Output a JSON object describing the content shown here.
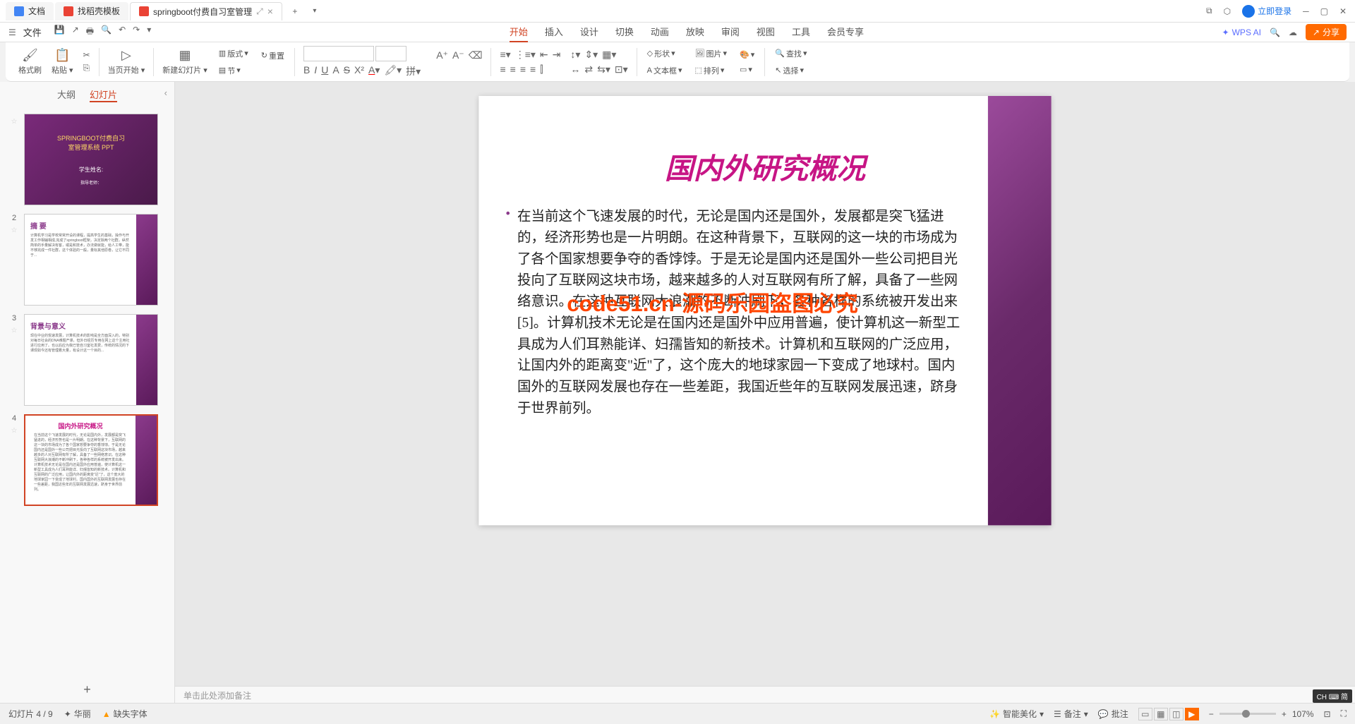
{
  "titlebar": {
    "tabs": [
      {
        "label": "文档",
        "icon": "doc"
      },
      {
        "label": "找稻壳模板",
        "icon": "tpl"
      },
      {
        "label": "springboot付费自习室管理",
        "icon": "ppt",
        "active": true
      }
    ],
    "login": "立即登录"
  },
  "menubar": {
    "file": "文件",
    "tabs": [
      "开始",
      "插入",
      "设计",
      "切换",
      "动画",
      "放映",
      "审阅",
      "视图",
      "工具",
      "会员专享"
    ],
    "active_tab": "开始",
    "wps_ai": "WPS AI",
    "share": "分享"
  },
  "ribbon": {
    "format_painter": "格式刷",
    "paste": "粘贴",
    "start_from": "当页开始",
    "new_slide": "新建幻灯片",
    "layout": "版式",
    "section": "节",
    "reset": "重置",
    "shape": "形状",
    "picture": "图片",
    "textbox": "文本框",
    "arrange": "排列",
    "find": "查找",
    "select": "选择"
  },
  "panel": {
    "outline": "大纲",
    "slides": "幻灯片"
  },
  "thumbnails": [
    {
      "num": "",
      "title1": "SPRINGBOOT付费自习",
      "title2": "室管理系统 PPT",
      "sub1": "学生姓名:",
      "sub2": "指导老师："
    },
    {
      "num": "2",
      "title": "摘 要"
    },
    {
      "num": "3",
      "title": "背景与意义"
    },
    {
      "num": "4",
      "title": "国内外研究概况"
    }
  ],
  "slide": {
    "title": "国内外研究概况",
    "body": "在当前这个飞速发展的时代，无论是国内还是国外，发展都是突飞猛进的，经济形势也是一片明朗。在这种背景下，互联网的这一块的市场成为了各个国家想要争夺的香饽饽。于是无论是国内还是国外一些公司把目光投向了互联网这块市场，越来越多的人对互联网有所了解，具备了一些网络意识。在这种互联网大浪潮的不断冲刷下，各种各样的系统被开发出来[5]。计算机技术无论是在国内还是国外中应用普遍，使计算机这一新型工具成为人们耳熟能详、妇孺皆知的新技术。计算机和互联网的广泛应用，让国内外的距离变\"近\"了，这个庞大的地球家园一下变成了地球村。国内国外的互联网发展也存在一些差距，我国近些年的互联网发展迅速，跻身于世界前列。",
    "watermark": "code51.cn-源码乐园盗图必究"
  },
  "notes": {
    "placeholder": "单击此处添加备注"
  },
  "statusbar": {
    "slide_info": "幻灯片 4 / 9",
    "theme": "华丽",
    "missing_font": "缺失字体",
    "beautify": "智能美化",
    "notes_btn": "备注",
    "comments": "批注",
    "zoom": "107%"
  },
  "ime": "CH ⌨ 简"
}
